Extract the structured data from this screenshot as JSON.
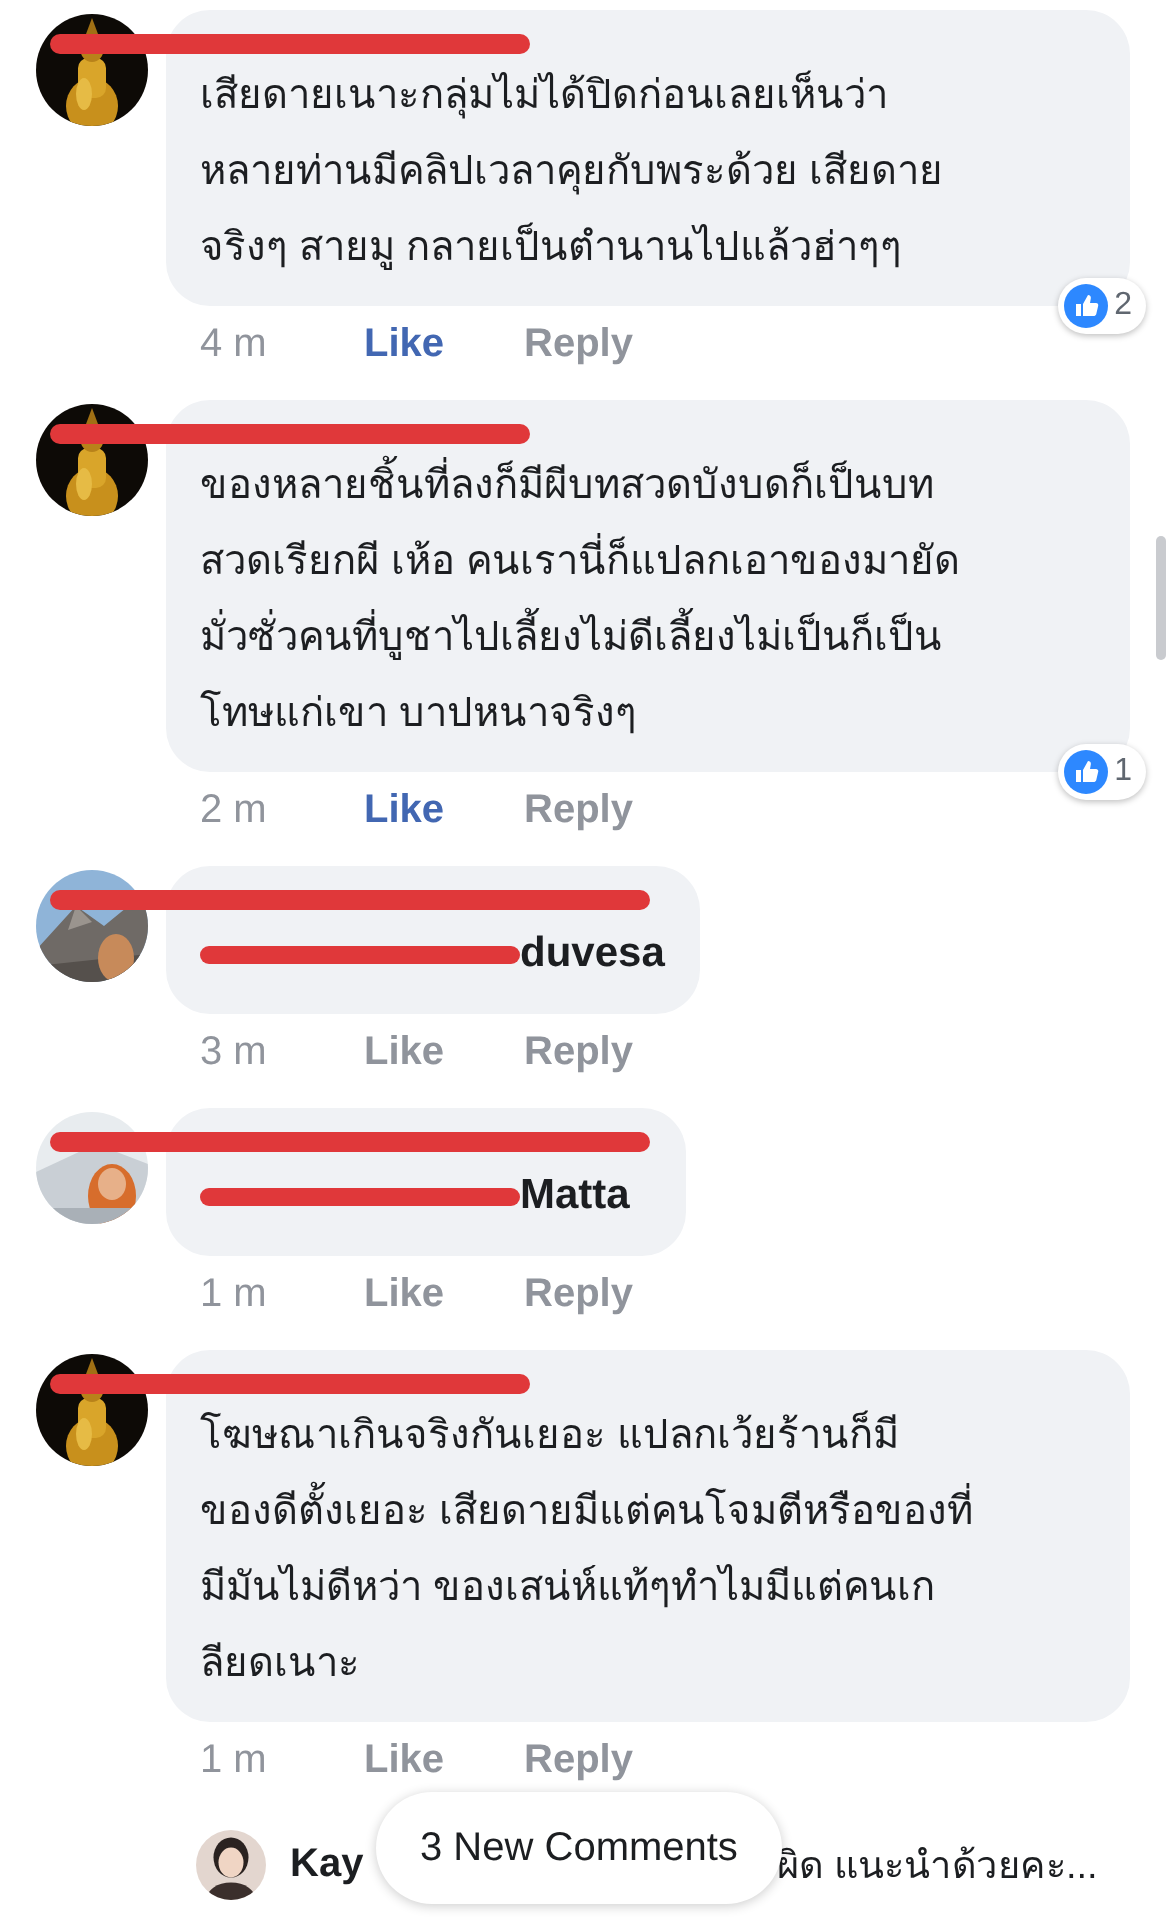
{
  "comments": [
    {
      "name_hidden": true,
      "kind": "text",
      "text": "เสียดายเนาะกลุ่มไม่ได้ปิดก่อนเลยเห็นว่า\nหลายท่านมีคลิปเวลาคุยกับพระด้วย เสียดาย\nจริงๆ สายมู กลายเป็นตำนานไปแล้วฮ่าๆๆ",
      "time": "4 m",
      "like": "Like",
      "liked": true,
      "reply": "Reply",
      "reactions": "2"
    },
    {
      "name_hidden": true,
      "kind": "text",
      "text": "ของหลายชิ้นที่ลงก็มีผีบทสวดบังบดก็เป็นบท\nสวดเรียกผี เห้อ คนเรานี่ก็แปลกเอาของมายัด\nมั่วซั่วคนที่บูชาไปเลี้ยงไม่ดีเลี้ยงไม่เป็นก็เป็น\nโทษแก่เขา บาปหนาจริงๆ",
      "time": "2 m",
      "like": "Like",
      "liked": true,
      "reply": "Reply",
      "reactions": "1"
    },
    {
      "name_hidden": true,
      "kind": "mention",
      "text": "duvesa",
      "time": "3 m",
      "like": "Like",
      "liked": false,
      "reply": "Reply"
    },
    {
      "name_hidden": true,
      "kind": "mention",
      "text": "Matta",
      "time": "1 m",
      "like": "Like",
      "liked": false,
      "reply": "Reply"
    },
    {
      "name_hidden": true,
      "kind": "text",
      "text": "โฆษณาเกินจริงกันเยอะ แปลกเว้ยร้านก็มี\nของดีตั้งเยอะ เสียดายมีแต่คนโจมตีหรือของที่\nมีมันไม่ดีหว่า ของเสน่ห์แท้ๆทำไมมีแต่คนเก\nลียดเนาะ",
      "time": "1 m",
      "like": "Like",
      "liked": false,
      "reply": "Reply"
    }
  ],
  "preview": {
    "name": "Kay",
    "text": "ผิด แนะนำด้วยคะ..."
  },
  "new_comments": "3 New Comments"
}
